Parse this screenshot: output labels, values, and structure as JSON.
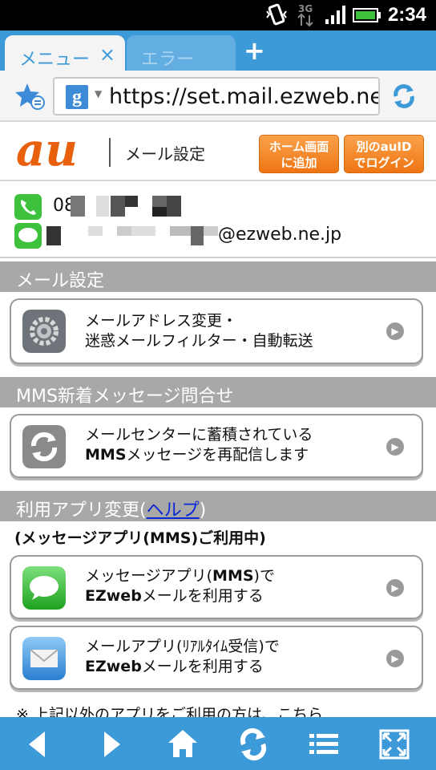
{
  "status_bar": {
    "time": "2:34",
    "network": "3G"
  },
  "tabs": {
    "active_label": "メニュー",
    "inactive_label": "エラー",
    "close": "×",
    "add": "+"
  },
  "url_bar": {
    "url": "https://set.mail.ezweb.ne.jp",
    "search_engine_letter": "g"
  },
  "header": {
    "logo": "au",
    "title": "メール設定",
    "home_button": [
      "ホーム画面",
      "に追加"
    ],
    "login_button": [
      "別のauID",
      "でログイン"
    ]
  },
  "account": {
    "phone": "08",
    "email_domain": "@ezweb.ne.jp"
  },
  "sections": {
    "mail_settings": "メール設定",
    "mms_inquiry": "MMS新着メッセージ問合せ",
    "app_change_prefix": "利用アプリ変更(",
    "app_change_link": "ヘルプ",
    "app_change_suffix": ")"
  },
  "cards": {
    "mail_address": {
      "line1": "メールアドレス変更・",
      "line2": "迷惑メールフィルター・自動転送",
      "icon": "settings-gear-icon"
    },
    "mms_resend": {
      "line1": "メールセンターに蓄積されている",
      "line2_bold": "MMS",
      "line2_rest": "メッセージを再配信します",
      "icon": "refresh-arrows-icon"
    },
    "message_app": {
      "line1_a": "メッセージアプリ(",
      "line1_bold": "MMS",
      "line1_b": ")で",
      "line2_bold": "EZweb",
      "line2_rest": "メールを利用する",
      "icon": "message-bubble-icon"
    },
    "mail_app": {
      "line1": "メールアプリ(ﾘｱﾙﾀｲﾑ受信)で",
      "line2_bold": "EZweb",
      "line2_rest": "メールを利用する",
      "icon": "envelope-icon"
    }
  },
  "current_app_note": "(メッセージアプリ(MMS)ご利用中)",
  "footnote": "※ 上記以外のアプリをご利用の方は、こちら",
  "colors": {
    "blue_bar": "#3d9ad8",
    "orange_button": "#ef7513",
    "section_gray": "#a8a8a8",
    "link": "#0a27d8"
  }
}
